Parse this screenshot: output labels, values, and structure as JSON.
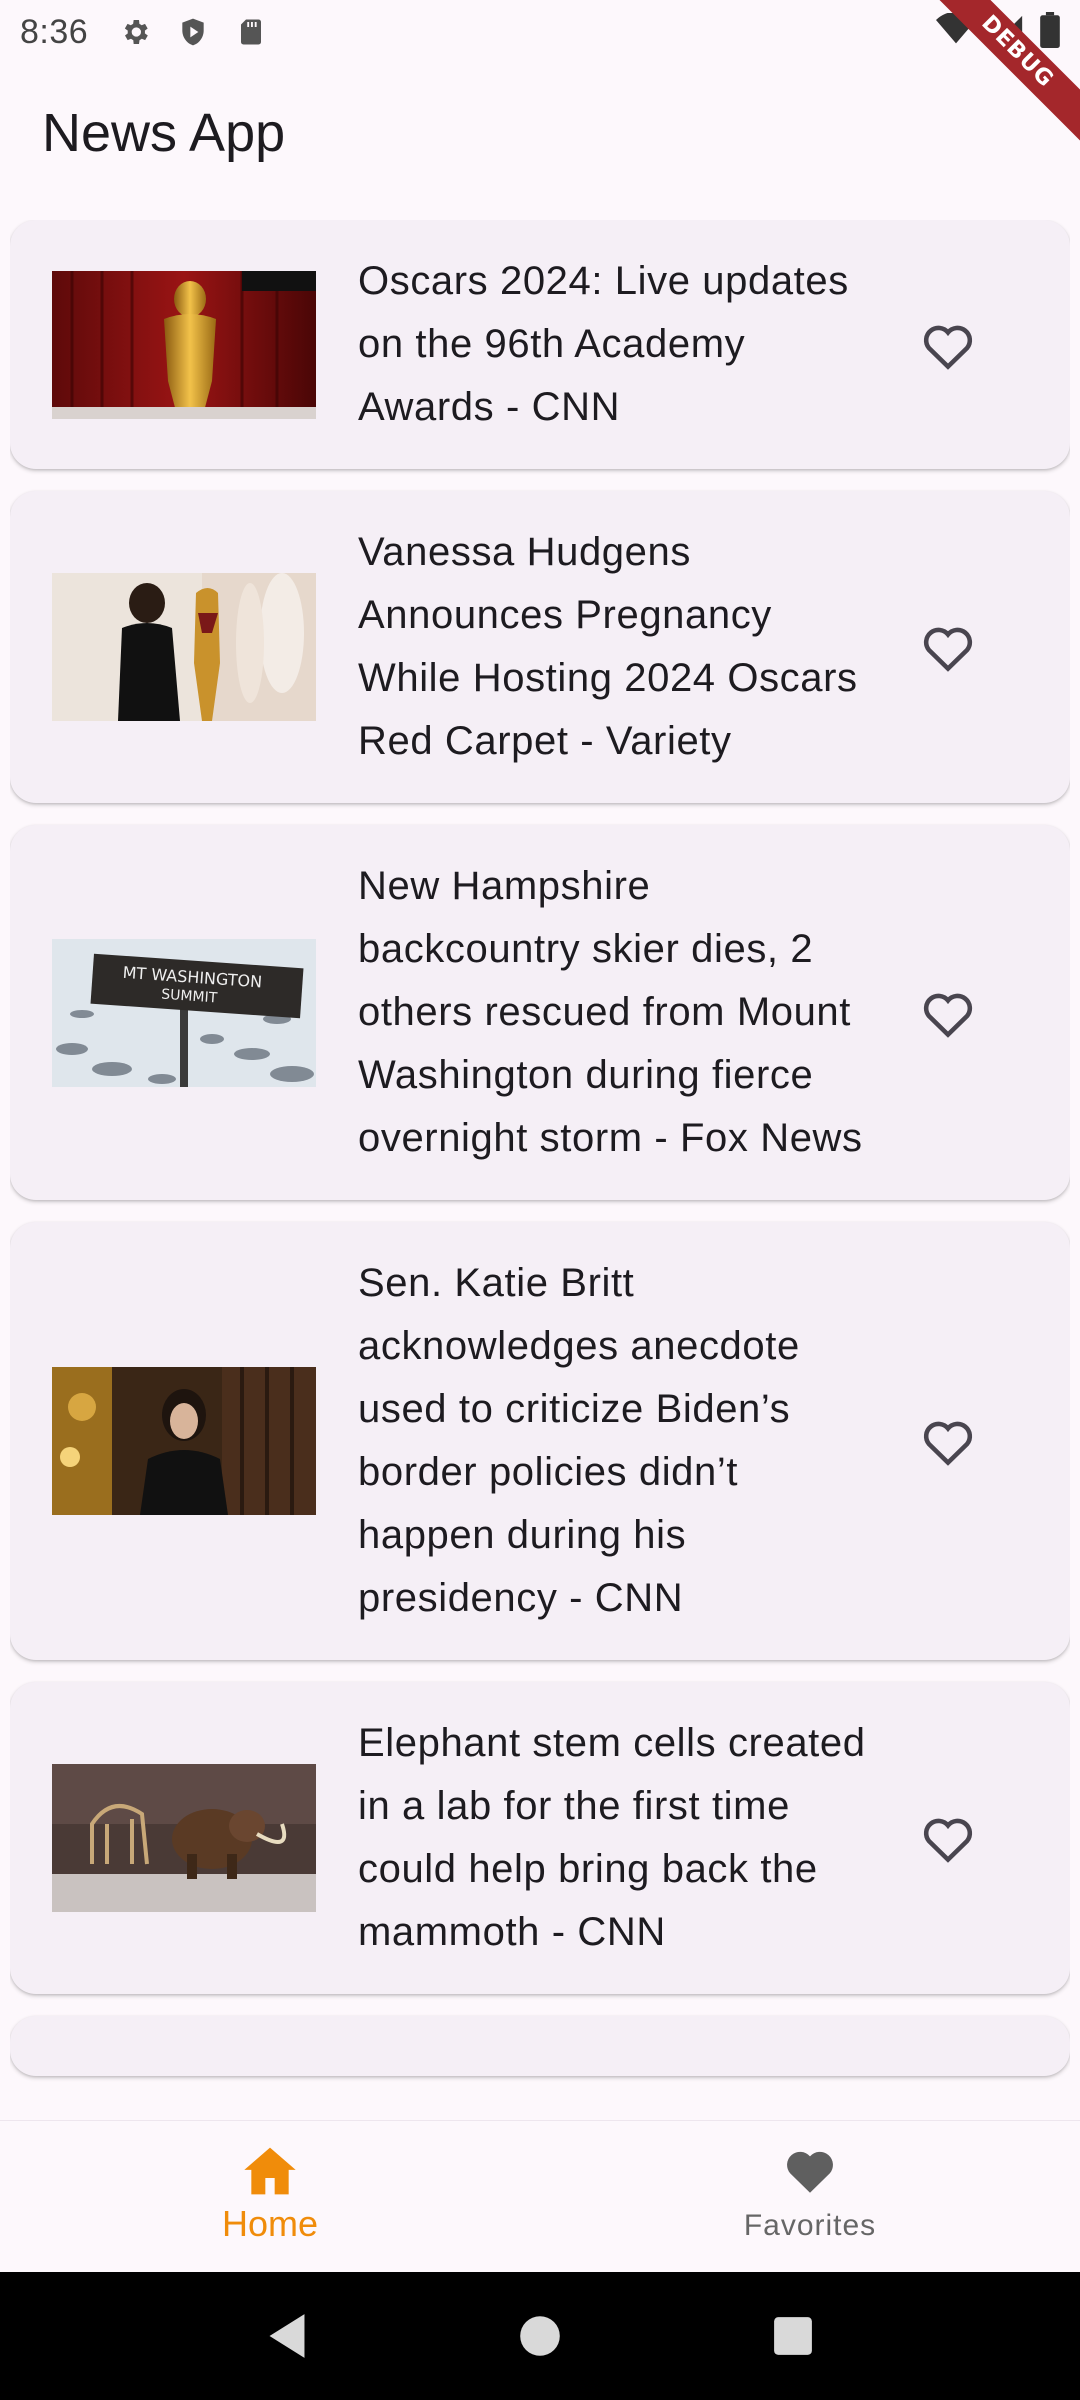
{
  "status_bar": {
    "time": "8:36"
  },
  "debug_label": "DEBUG",
  "app_bar": {
    "title": "News App"
  },
  "articles": [
    {
      "title": "Oscars 2024: Live updates on the 96th Academy Awards - CNN",
      "thumbnail": "oscar-statue-red-curtain"
    },
    {
      "title": "Vanessa Hudgens Announces Pregnancy While Hosting 2024 Oscars Red Carpet - Variety",
      "thumbnail": "woman-in-black-dress-oscar-statue"
    },
    {
      "title": "New Hampshire backcountry skier dies, 2 others rescued from Mount Washington during fierce overnight storm - Fox News",
      "thumbnail": "mt-washington-summit-sign"
    },
    {
      "title": "Sen. Katie Britt acknowledges anecdote used to criticize Biden’s border policies didn’t happen during his presidency - CNN",
      "thumbnail": "woman-portrait-interior"
    },
    {
      "title": "Elephant stem cells created in a lab for the first time could help bring back the mammoth - CNN",
      "thumbnail": "mammoth-museum-exhibit"
    }
  ],
  "bottom_nav": {
    "home_label": "Home",
    "favorites_label": "Favorites"
  },
  "colors": {
    "accent": "#f08c0a",
    "card_bg": "#f5eff6",
    "page_bg": "#fdf8fc"
  }
}
